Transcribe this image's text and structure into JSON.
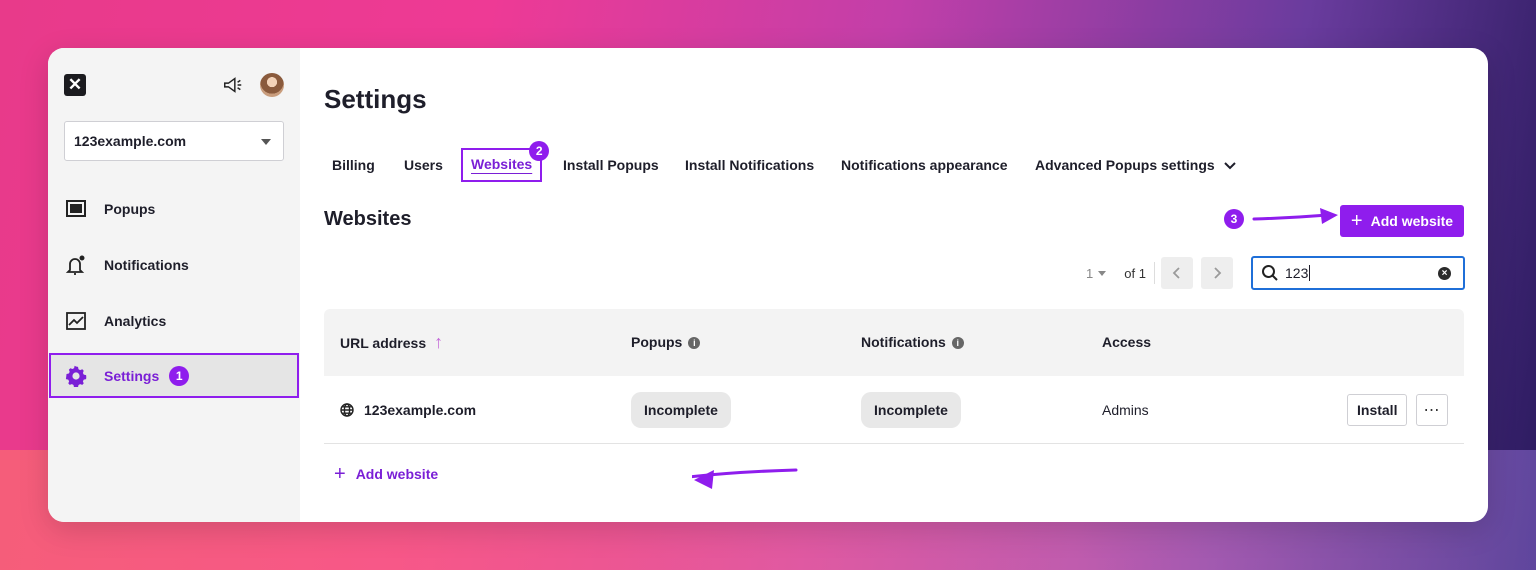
{
  "app": {
    "logo_glyph": "✕",
    "accent_color": "#8f1ded",
    "focus_color": "#1f6fd8"
  },
  "sidebar": {
    "site_selector": {
      "value": "123example.com"
    },
    "items": [
      {
        "label": "Popups",
        "icon": "popup-window-icon"
      },
      {
        "label": "Notifications",
        "icon": "bell-icon"
      },
      {
        "label": "Analytics",
        "icon": "line-chart-icon"
      },
      {
        "label": "Settings",
        "icon": "gear-icon",
        "active": true,
        "step_badge": "1"
      }
    ]
  },
  "main": {
    "title": "Settings",
    "tabs": [
      {
        "label": "Billing"
      },
      {
        "label": "Users"
      },
      {
        "label": "Websites",
        "active": true,
        "step_badge": "2"
      },
      {
        "label": "Install Popups"
      },
      {
        "label": "Install Notifications"
      },
      {
        "label": "Notifications appearance"
      },
      {
        "label": "Advanced Popups settings",
        "has_dropdown": true
      }
    ],
    "section_title": "Websites",
    "step3_badge": "3",
    "add_website_button": {
      "label": "Add website"
    },
    "pagination": {
      "page": "1",
      "of_label": "of 1"
    },
    "search": {
      "value": "123"
    },
    "table": {
      "columns": [
        "URL address",
        "Popups",
        "Notifications",
        "Access"
      ],
      "rows": [
        {
          "url": "123example.com",
          "popups": "Incomplete",
          "notifications": "Incomplete",
          "access": "Admins",
          "install_label": "Install",
          "more_label": "⋯"
        }
      ]
    },
    "add_website_link": {
      "label": "Add website"
    }
  }
}
